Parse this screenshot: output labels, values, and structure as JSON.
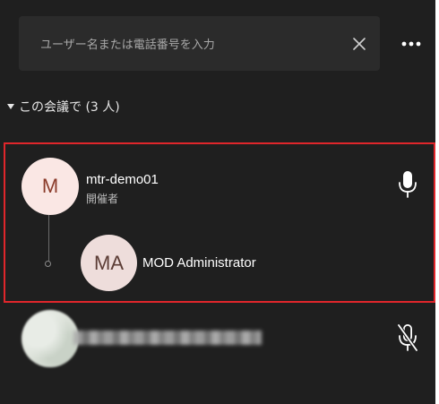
{
  "search": {
    "placeholder": "ユーザー名または電話番号を入力"
  },
  "section": {
    "label": "この会議で (3 人)"
  },
  "participants": [
    {
      "initials": "M",
      "name": "mtr-demo01",
      "role": "開催者",
      "mic": "mic-on"
    },
    {
      "initials": "MA",
      "name": "MOD Administrator"
    },
    {
      "mic": "mic-muted"
    }
  ],
  "colors": {
    "background": "#1f1f1f",
    "search_background": "#2b2b2b",
    "highlight_border": "#e0262b",
    "avatar_m_background": "#fae7e4",
    "avatar_ma_background": "#eedddb"
  }
}
